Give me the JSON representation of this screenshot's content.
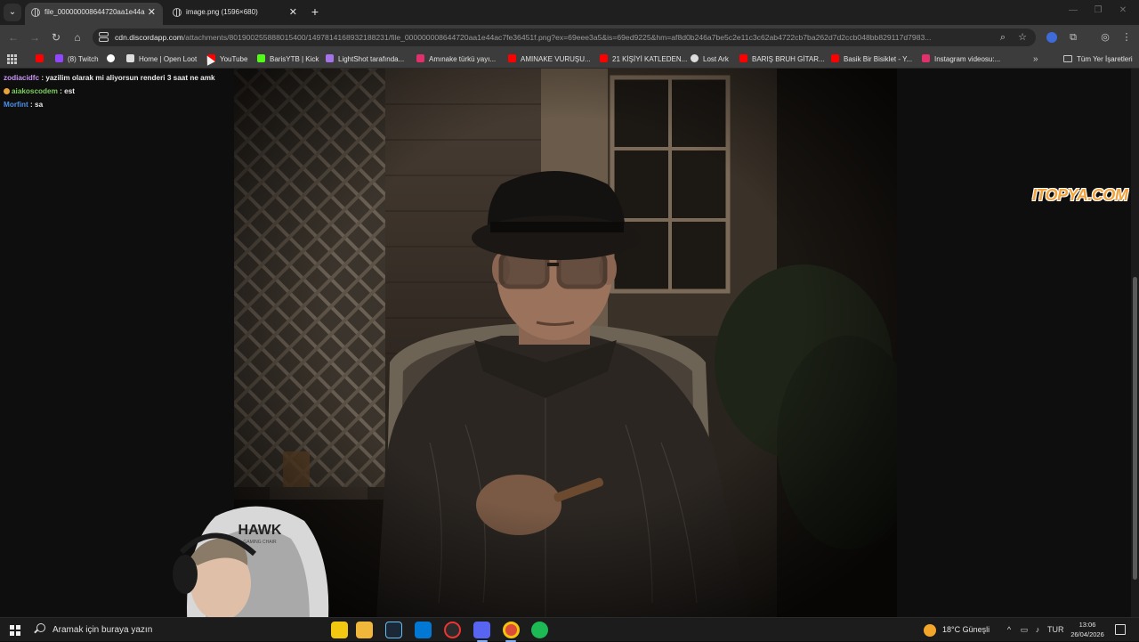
{
  "tabs": [
    {
      "title": "file_000000008644720aa1e44a",
      "active": true
    },
    {
      "title": "image.png (1596×680)",
      "active": false
    }
  ],
  "address_bar": {
    "host": "cdn.discordapp.com",
    "path": "/attachments/801900255888015400/1497814168932188231/file_000000008644720aa1e44ac7fe36451f.png?ex=69eee3a5&is=69ed9225&hm=af8d0b246a7be5c2e11c3c62ab4722cb7ba262d7d2ccb048bb829117d7983..."
  },
  "bookmarks": [
    {
      "label": "(8) Twitch",
      "icon": "twitch-icon",
      "color": "#9146ff"
    },
    {
      "label": "Home | Open Loot",
      "icon": "openloot-icon",
      "color": "#dddddd"
    },
    {
      "label": "YouTube",
      "icon": "youtube-icon",
      "color": "#ff0000"
    },
    {
      "label": "BarisYTB | Kick",
      "icon": "kick-icon",
      "color": "#53fc18"
    },
    {
      "label": "LightShot tarafında...",
      "icon": "lightshot-icon",
      "color": "#a574e8"
    },
    {
      "label": "Amınake türkü yayı...",
      "icon": "instagram-icon",
      "color": "#e1306c"
    },
    {
      "label": "AMINAKE VURUŞU...",
      "icon": "youtube-icon",
      "color": "#ff0000"
    },
    {
      "label": "21 KİŞİYİ KATLEDEN...",
      "icon": "youtube-icon",
      "color": "#ff0000"
    },
    {
      "label": "Lost Ark",
      "icon": "lostark-icon",
      "color": "#dddddd"
    },
    {
      "label": "BARIŞ BRUH GİTAR...",
      "icon": "youtube-icon",
      "color": "#ff0000"
    },
    {
      "label": "Basik Bir Bisiklet - Y...",
      "icon": "youtube-icon",
      "color": "#ff0000"
    },
    {
      "label": "Instagram videosu:...",
      "icon": "instagram-icon",
      "color": "#e1306c"
    }
  ],
  "bookmarks_folder": "Tüm Yer İşaretleri",
  "chat": [
    {
      "user": "zodiacidfc",
      "message": " : yazilim olarak mi aliyorsun renderi 3 saat ne amk",
      "badge": false
    },
    {
      "user": "aiakoscodem",
      "message": " : est",
      "badge": true
    },
    {
      "user": "Morfint",
      "message": " : sa",
      "badge": false
    }
  ],
  "overlay_logo": "ITOPYA.COM",
  "webcam": {
    "chair_brand": "HAWK",
    "chair_sub": "GAMING CHAIR"
  },
  "taskbar": {
    "search_placeholder": "Aramak için buraya yazın",
    "weather": "18°C  Güneşli",
    "language": "TUR",
    "time": "13:06",
    "date": "26/04/2026"
  }
}
